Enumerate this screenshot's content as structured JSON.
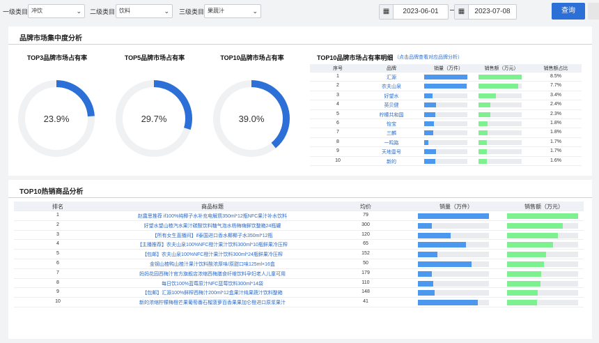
{
  "filters": {
    "cat1_label": "一级类目：",
    "cat1_value": "冲饮",
    "cat2_label": "二级类目：",
    "cat2_value": "饮料",
    "cat3_label": "三级类目：",
    "cat3_value": "果蔬汁",
    "date_start": "2023-06-01",
    "date_end": "2023-07-08",
    "query_button": "查询"
  },
  "concentration": {
    "title": "品牌市场集中度分析",
    "donuts": [
      {
        "title": "TOP3品牌市场占有率",
        "value_text": "23.9%",
        "value": 23.9
      },
      {
        "title": "TOP5品牌市场占有率",
        "value_text": "29.7%",
        "value": 29.7
      },
      {
        "title": "TOP10品牌市场占有率",
        "value_text": "39.0%",
        "value": 39.0
      }
    ],
    "detail_title": "TOP10品牌市场占有率明细",
    "detail_link": "（点击品牌查看对应品牌分析）",
    "detail_headers": [
      "序号",
      "品牌",
      "销量（万件）",
      "销售额（万元）",
      "销售额占比"
    ],
    "detail_rows": [
      {
        "rank": "1",
        "brand": "汇源",
        "sales": 1.0,
        "revenue": 1.0,
        "share": "8.5%"
      },
      {
        "rank": "2",
        "brand": "农夫山泉",
        "sales": 0.98,
        "revenue": 0.92,
        "share": "7.7%"
      },
      {
        "rank": "3",
        "brand": "好望水",
        "sales": 0.2,
        "revenue": 0.4,
        "share": "3.4%"
      },
      {
        "rank": "4",
        "brand": "英贝健",
        "sales": 0.27,
        "revenue": 0.28,
        "share": "2.4%"
      },
      {
        "rank": "5",
        "brand": "柠檬共和国",
        "sales": 0.25,
        "revenue": 0.27,
        "share": "2.3%"
      },
      {
        "rank": "6",
        "brand": "怡宝",
        "sales": 0.22,
        "revenue": 0.21,
        "share": "1.8%"
      },
      {
        "rank": "7",
        "brand": "三麟",
        "sales": 0.21,
        "revenue": 0.21,
        "share": "1.8%"
      },
      {
        "rank": "8",
        "brand": "一鸣路",
        "sales": 0.1,
        "revenue": 0.2,
        "share": "1.7%"
      },
      {
        "rank": "9",
        "brand": "天地壹号",
        "sales": 0.28,
        "revenue": 0.2,
        "share": "1.7%"
      },
      {
        "rank": "10",
        "brand": "新的",
        "sales": 0.26,
        "revenue": 0.19,
        "share": "1.6%"
      }
    ]
  },
  "hot": {
    "title": "TOP10热销商品分析",
    "headers": [
      "排名",
      "商品标题",
      "均价",
      "销量（万件）",
      "销售额（万元）"
    ],
    "rows": [
      {
        "rank": "1",
        "title": "赵露思推荐 if100%纯椰子水补充电解质350ml*12瓶NFC果汁补水饮料",
        "price": "79",
        "sales": 1.0,
        "revenue": 1.0
      },
      {
        "rank": "2",
        "title": "好望水望山楂汽水果汁碳酸饮料糖气泡水杨梅嗨鲜饮整箱24瓶罐",
        "price": "300",
        "sales": 0.2,
        "revenue": 0.78
      },
      {
        "rank": "3",
        "title": "【所有女生直播间】if泰国进口香水椰椰子水350ml*12瓶",
        "price": "120",
        "sales": 0.46,
        "revenue": 0.72
      },
      {
        "rank": "4",
        "title": "【主播推荐】农夫山泉100%NFC橙汁果汁饮料300ml*10瓶鲜果冷压榨",
        "price": "65",
        "sales": 0.68,
        "revenue": 0.65
      },
      {
        "rank": "5",
        "title": "【包邮】农夫山泉100%NFC橙汁果汁饮料300ml*24瓶鲜果冷压榨",
        "price": "152",
        "sales": 0.27,
        "revenue": 0.55
      },
      {
        "rank": "6",
        "title": "金钢山楂鸭山楂汁果汁饮料酸浓厚味/原甜口味125ml×16盒",
        "price": "50",
        "sales": 0.75,
        "revenue": 0.52
      },
      {
        "rank": "7",
        "title": "妈妈花园西梅汁官方旗舰店浓缩西梅膳食纤维饮料孕妇老人儿童可用",
        "price": "179",
        "sales": 0.2,
        "revenue": 0.48
      },
      {
        "rank": "8",
        "title": "每日饮100%蓝莓原汁NFC蓝莓饮料300ml*14袋",
        "price": "110",
        "sales": 0.22,
        "revenue": 0.47
      },
      {
        "rank": "9",
        "title": "【包邮】汇源100%鲜榨西梅汁200ml*12盒果汁纯果蔬汁饮料整箱",
        "price": "148",
        "sales": 0.24,
        "revenue": 0.43
      },
      {
        "rank": "10",
        "title": "新的浓缩柠檬梅橙芒果葡萄番石榴菠萝百香果果加仑橙进口原浆果汁",
        "price": "41",
        "sales": 0.84,
        "revenue": 0.42
      }
    ]
  },
  "colors": {
    "accent": "#2c6fd6",
    "sales_bar": "#4b98ee",
    "revenue_bar": "#7df08f",
    "ring_bg": "#f0f1f3"
  }
}
